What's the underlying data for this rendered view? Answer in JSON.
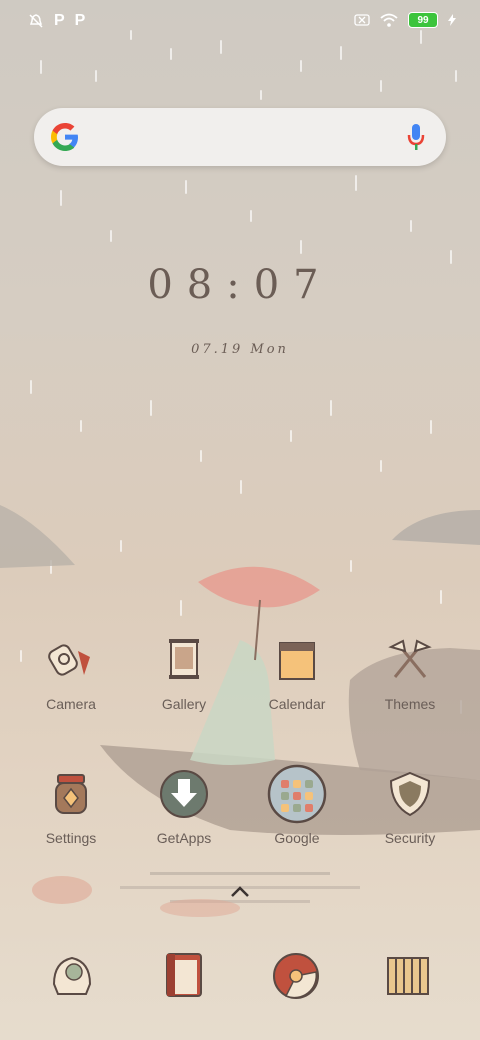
{
  "status_bar": {
    "battery_level": "99",
    "left_icons": [
      "notification-off-icon",
      "p-icon",
      "p-icon"
    ],
    "right_icons": [
      "sim-off-icon",
      "wifi-icon",
      "battery-icon",
      "charging-icon"
    ]
  },
  "search": {
    "google_logo": "google-logo-icon",
    "mic": "mic-icon"
  },
  "clock": {
    "time": "08:07",
    "date": "07.19 Mon"
  },
  "apps_row1": [
    {
      "label": "Camera",
      "icon": "camera-icon"
    },
    {
      "label": "Gallery",
      "icon": "gallery-icon"
    },
    {
      "label": "Calendar",
      "icon": "calendar-icon"
    },
    {
      "label": "Themes",
      "icon": "themes-icon"
    }
  ],
  "apps_row2": [
    {
      "label": "Settings",
      "icon": "settings-icon"
    },
    {
      "label": "GetApps",
      "icon": "getapps-icon"
    },
    {
      "label": "Google",
      "icon": "google-folder-icon"
    },
    {
      "label": "Security",
      "icon": "security-icon"
    }
  ],
  "dock": [
    "phone-icon",
    "messages-icon",
    "browser-icon",
    "app-drawer-icon"
  ],
  "colors": {
    "text": "#6a5e58",
    "battery": "#3cc43c",
    "accent_umbrella": "#e79a8e"
  }
}
